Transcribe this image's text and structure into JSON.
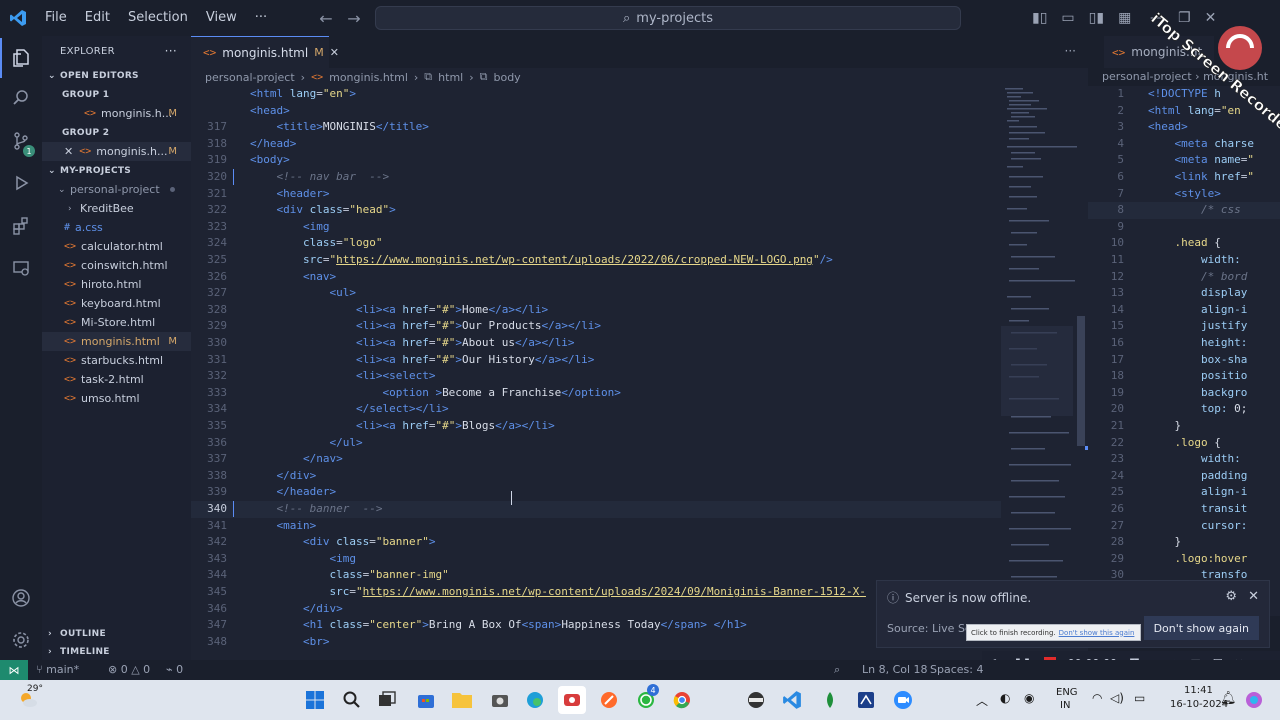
{
  "titlebar": {
    "menu": [
      "File",
      "Edit",
      "Selection",
      "View",
      "···"
    ],
    "search": "my-projects"
  },
  "sidebar": {
    "title": "EXPLORER",
    "open_editors": "OPEN EDITORS",
    "group1": "GROUP 1",
    "group1_file": "monginis.h...",
    "group2": "GROUP 2",
    "group2_file": "monginis.h...",
    "modified": "M",
    "project_section": "MY-PROJECTS",
    "folder": "personal-project",
    "files": [
      "KreditBee",
      "a.css",
      "calculator.html",
      "coinswitch.html",
      "hiroto.html",
      "keyboard.html",
      "Mi-Store.html",
      "monginis.html",
      "starbucks.html",
      "task-2.html",
      "umso.html"
    ],
    "outline": "OUTLINE",
    "timeline": "TIMELINE",
    "source_control_badge": "1"
  },
  "editor": {
    "tab_label": "monginis.html",
    "tab_modified": "M",
    "breadcrumb": [
      "personal-project",
      "monginis.html",
      "html",
      "body"
    ],
    "current_line": "340"
  },
  "split": {
    "tab_label": "monginis.ht",
    "breadcrumb": [
      "personal-project",
      "monginis.ht"
    ]
  },
  "notification": {
    "message": "Server is now offline.",
    "source": "Source: Live Serve",
    "button": "Don't show again",
    "tooltip": "Click to finish recording.",
    "tooltip_link": "Don't show this again"
  },
  "recorder": {
    "time": "00:00:00"
  },
  "statusbar": {
    "branch": "main*",
    "errors": "0",
    "warnings": "0",
    "ports": "0",
    "position": "Ln 8, Col 18",
    "spaces": "Spaces: 4"
  },
  "taskbar": {
    "weather": "29°",
    "lang1": "ENG",
    "lang2": "IN",
    "time": "11:41",
    "date": "16-10-2024",
    "whatsapp_badge": "4"
  },
  "watermark": "iTop Screen Recorder"
}
